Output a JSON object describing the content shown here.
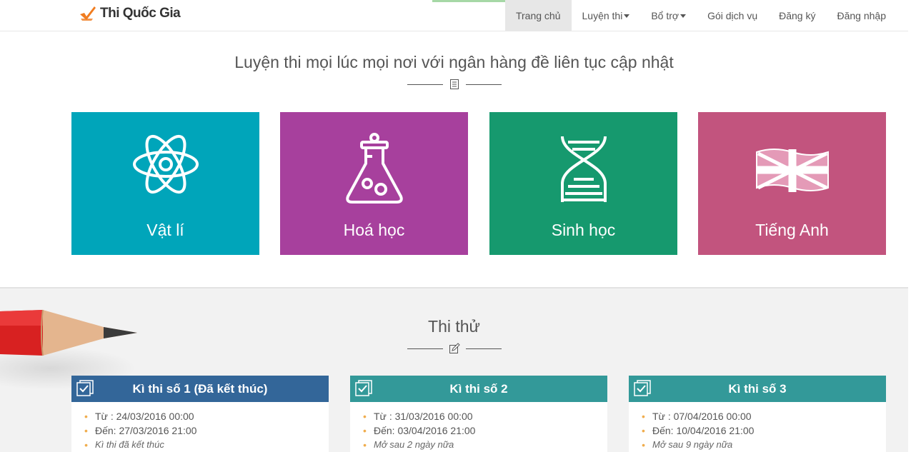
{
  "brand": {
    "name": "Thi Quốc Gia"
  },
  "nav": {
    "items": [
      {
        "label": "Trang chủ",
        "active": true,
        "dropdown": false
      },
      {
        "label": "Luyện thi",
        "active": false,
        "dropdown": true
      },
      {
        "label": "Bổ trợ",
        "active": false,
        "dropdown": true
      },
      {
        "label": "Gói dịch vụ",
        "active": false,
        "dropdown": false
      },
      {
        "label": "Đăng ký",
        "active": false,
        "dropdown": false
      },
      {
        "label": "Đăng nhập",
        "active": false,
        "dropdown": false
      }
    ]
  },
  "practice": {
    "heading": "Luyện thi mọi lúc mọi nơi với ngân hàng đề liên tục cập nhật",
    "subjects": [
      {
        "label": "Vật lí",
        "icon": "atom-icon",
        "color": "#00a5ba"
      },
      {
        "label": "Hoá học",
        "icon": "flask-icon",
        "color": "#a7409d"
      },
      {
        "label": "Sinh học",
        "icon": "dna-icon",
        "color": "#16996e"
      },
      {
        "label": "Tiếng Anh",
        "icon": "uk-flag-icon",
        "color": "#c2547e"
      }
    ]
  },
  "mock_exams": {
    "heading": "Thi thử",
    "cards": [
      {
        "title": "Kì thi số 1 (Đã kết thúc)",
        "color": "#336699",
        "from": "Từ : 24/03/2016 00:00",
        "to": "Đến: 27/03/2016 21:00",
        "note": "Kì thi đã kết thúc"
      },
      {
        "title": "Kì thi số 2",
        "color": "#339999",
        "from": "Từ : 31/03/2016 00:00",
        "to": "Đến: 03/04/2016 21:00",
        "note": "Mở sau 2 ngày nữa"
      },
      {
        "title": "Kì thi số 3",
        "color": "#339999",
        "from": "Từ : 07/04/2016 00:00",
        "to": "Đến: 10/04/2016 21:00",
        "note": "Mở sau 9 ngày nữa"
      }
    ]
  }
}
